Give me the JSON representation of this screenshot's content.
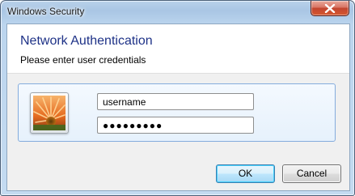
{
  "window": {
    "title": "Windows Security"
  },
  "header": {
    "heading": "Network Authentication",
    "subheading": "Please enter user credentials"
  },
  "credentials": {
    "username_value": "username",
    "password_value": "●●●●●●●●●",
    "tile_icon": "flower-icon"
  },
  "buttons": {
    "ok_label": "OK",
    "cancel_label": "Cancel"
  },
  "colors": {
    "heading": "#1e3287",
    "panel_border": "#84acdd",
    "close_button": "#c24530"
  }
}
